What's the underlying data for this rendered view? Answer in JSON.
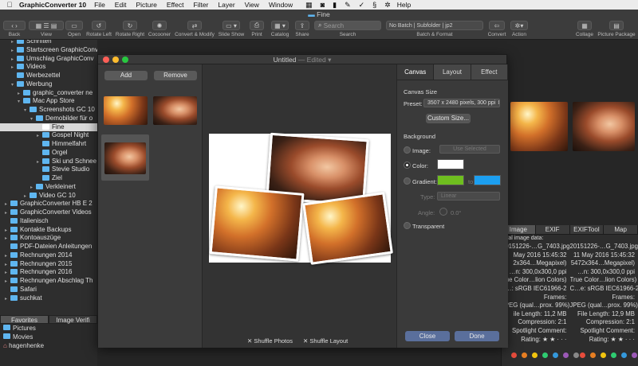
{
  "menubar": {
    "apple": "",
    "app": "GraphicConverter 10",
    "items": [
      "File",
      "Edit",
      "Picture",
      "Effect",
      "Filter",
      "Layer",
      "View",
      "Window",
      "Help"
    ]
  },
  "window": {
    "title": "Fine"
  },
  "toolbar": {
    "back": "Back",
    "view": "View",
    "open": "Open",
    "rotate_left": "Rotate Left",
    "rotate_right": "Rotate Right",
    "cocoonr": "Cocooner",
    "convert_modify": "Convert & Modify",
    "slide_show": "Slide Show",
    "print": "Print",
    "catalog": "Catalog",
    "share": "Share",
    "search_placeholder": "Search",
    "search_label": "Search",
    "batch_value": "No Batch | Subfolder | jp2",
    "batch_label": "Batch & Format",
    "convert": "Convert",
    "action": "Action",
    "collage": "Collage",
    "picture_package": "Picture Package"
  },
  "sidebar": {
    "items": [
      "Schriften",
      "Startscreen GraphicConverter",
      "Umschlag GraphicConv",
      "Videos",
      "Werbezettel",
      "Werbung",
      "graphic_converter ne",
      "Mac App Store",
      "Screenshots GC 10",
      "Demobilder für o",
      "Fine",
      "Gospel Night",
      "Himmelfahrt",
      "Orgel",
      "Ski und Schnee",
      "Stevie Studio",
      "Ziel",
      "Verkleinert",
      "Video GC 10",
      "GraphicConverter HB E 2",
      "GraphicConverter Videos",
      "Italienisch",
      "Kontakte Backups",
      "Kontoauszüge",
      "PDF-Dateien Anleitungen",
      "Rechnungen 2014",
      "Rechnungen 2015",
      "Rechnungen 2016",
      "Rechnungen Abschlag Th",
      "Safari",
      "suchkat"
    ]
  },
  "favorites": {
    "tabs": [
      "Favorites",
      "Image Verifi"
    ],
    "items": [
      "Pictures",
      "Movies",
      "hagenhenke"
    ]
  },
  "dialog": {
    "title": "Untitled",
    "edited": "— Edited",
    "add": "Add",
    "remove": "Remove",
    "shuffle_photos": "Shuffle Photos",
    "shuffle_layout": "Shuffle Layout",
    "tabs": [
      "Canvas",
      "Layout",
      "Effect"
    ],
    "canvas_size_label": "Canvas Size",
    "preset_label": "Preset:",
    "preset_value": "3507 x 2480 pixels, 300 ppi",
    "custom_size": "Custom Size...",
    "background_label": "Background",
    "image_label": "Image:",
    "use_selected": "Use Selected",
    "color_label": "Color:",
    "gradient_label": "Gradient:",
    "to_label": "to",
    "type_label": "Type:",
    "type_value": "Linear",
    "angle_label": "Angle:",
    "angle_value": "0.0°",
    "transparent_label": "Transparent",
    "close": "Close",
    "done": "Done",
    "color_value": "#ffffff",
    "gradient_from": "#6fbf1f",
    "gradient_to": "#1c9ff0"
  },
  "inspector": {
    "tabs": [
      "Image",
      "EXIF",
      "EXIFTool",
      "Map"
    ],
    "header": "ral image data:",
    "rows": [
      [
        "20151226-…G_7403.jpg",
        "20151226-…G_7403.jpg"
      ],
      [
        "May 2016 15:45:32",
        "11 May 2016 15:45:32"
      ],
      [
        "2x364…Megapixel)",
        "5472x364…Megapixel)"
      ],
      [
        "…n: 300,0x300,0 ppi",
        "…n: 300,0x300,0 ppi"
      ],
      [
        "rue Color…lion Colors)",
        "True Color…lion Colors)"
      ],
      [
        "…: sRGB IEC61966-2",
        "C…e: sRGB IEC61966-2"
      ],
      [
        "Frames:",
        "Frames:"
      ],
      [
        "JPEG (qual…prox. 99%)",
        "JPEG (qual…prox. 99%)"
      ],
      [
        "ile Length: 11,2 MB",
        "File Length: 12,9 MB"
      ],
      [
        "Compression: 2:1",
        "Compression: 2:1"
      ],
      [
        "Spotlight Comment:",
        "Spotlight Comment:"
      ],
      [
        "Rating: ★ ★ · · ·",
        "Rating: ★ ★ · · ·"
      ]
    ]
  },
  "colors": {
    "label_dots": [
      "#e74c3c",
      "#e67e22",
      "#f1c40f",
      "#2ecc71",
      "#3498db",
      "#9b59b6",
      "#888888"
    ]
  }
}
